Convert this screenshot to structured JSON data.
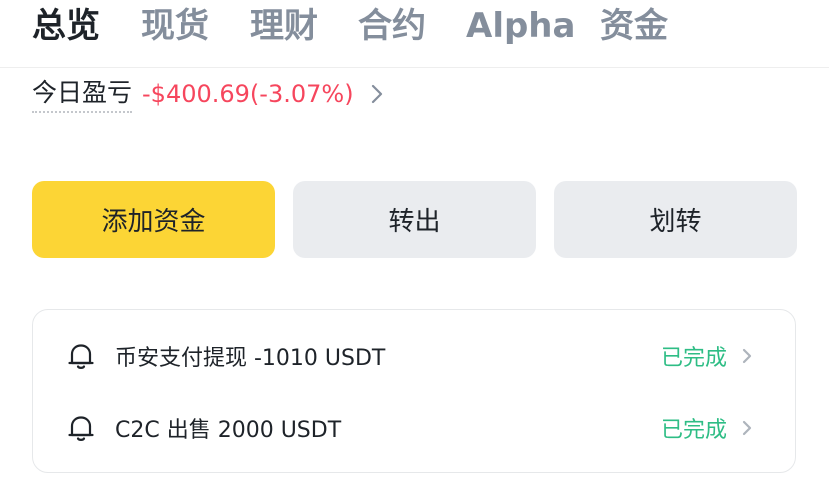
{
  "tabs": [
    {
      "label": "总览",
      "active": true
    },
    {
      "label": "现货",
      "active": false
    },
    {
      "label": "理财",
      "active": false
    },
    {
      "label": "合约",
      "active": false
    },
    {
      "label": "Alpha",
      "active": false
    },
    {
      "label": "资金",
      "active": false
    }
  ],
  "pnl": {
    "label": "今日盈亏",
    "value": "-$400.69(-3.07%)"
  },
  "actions": {
    "add_funds": "添加资金",
    "withdraw": "转出",
    "transfer": "划转"
  },
  "notices": [
    {
      "text": "币安支付提现 -1010 USDT",
      "status": "已完成"
    },
    {
      "text": "C2C 出售 2000 USDT",
      "status": "已完成"
    }
  ],
  "colors": {
    "accent_yellow": "#fcd535",
    "loss_red": "#f6465d",
    "success_green": "#2ebd85",
    "secondary_button": "#eaecef"
  },
  "icons": {
    "pnl_chevron": "chevron-right-icon",
    "notice": "bell-icon",
    "row_chevron": "chevron-right-icon"
  }
}
